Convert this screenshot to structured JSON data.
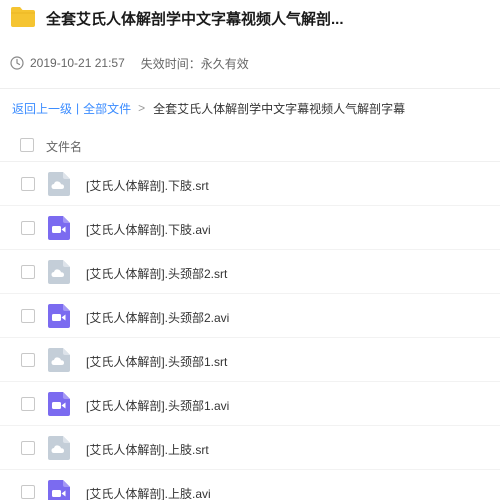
{
  "header": {
    "title": "全套艾氏人体解剖学中文字幕视频人气解剖...",
    "folder_icon": "folder-icon",
    "folder_color": "#f5c431"
  },
  "meta": {
    "date": "2019-10-21 21:57",
    "expire": "失效时间：永久有效",
    "clock_icon": "clock-icon"
  },
  "breadcrumb": {
    "back": "返回上一级",
    "separator": "|",
    "all_files": "全部文件",
    "arrow": ">",
    "current": "全套艾氏人体解剖学中文字幕视频人气解剖字幕"
  },
  "list_header": {
    "column_name": "文件名"
  },
  "colors": {
    "link": "#3b8cff",
    "subtitle_icon": "#c4ced8",
    "video_icon": "#7b6bf0"
  },
  "files": [
    {
      "name": "[艾氏人体解剖].下肢.srt",
      "type": "subtitle",
      "icon": "subtitle-file-icon"
    },
    {
      "name": "[艾氏人体解剖].下肢.avi",
      "type": "video",
      "icon": "video-file-icon"
    },
    {
      "name": "[艾氏人体解剖].头颈部2.srt",
      "type": "subtitle",
      "icon": "subtitle-file-icon"
    },
    {
      "name": "[艾氏人体解剖].头颈部2.avi",
      "type": "video",
      "icon": "video-file-icon"
    },
    {
      "name": "[艾氏人体解剖].头颈部1.srt",
      "type": "subtitle",
      "icon": "subtitle-file-icon"
    },
    {
      "name": "[艾氏人体解剖].头颈部1.avi",
      "type": "video",
      "icon": "video-file-icon"
    },
    {
      "name": "[艾氏人体解剖].上肢.srt",
      "type": "subtitle",
      "icon": "subtitle-file-icon"
    },
    {
      "name": "[艾氏人体解剖].上肢.avi",
      "type": "video",
      "icon": "video-file-icon"
    }
  ]
}
